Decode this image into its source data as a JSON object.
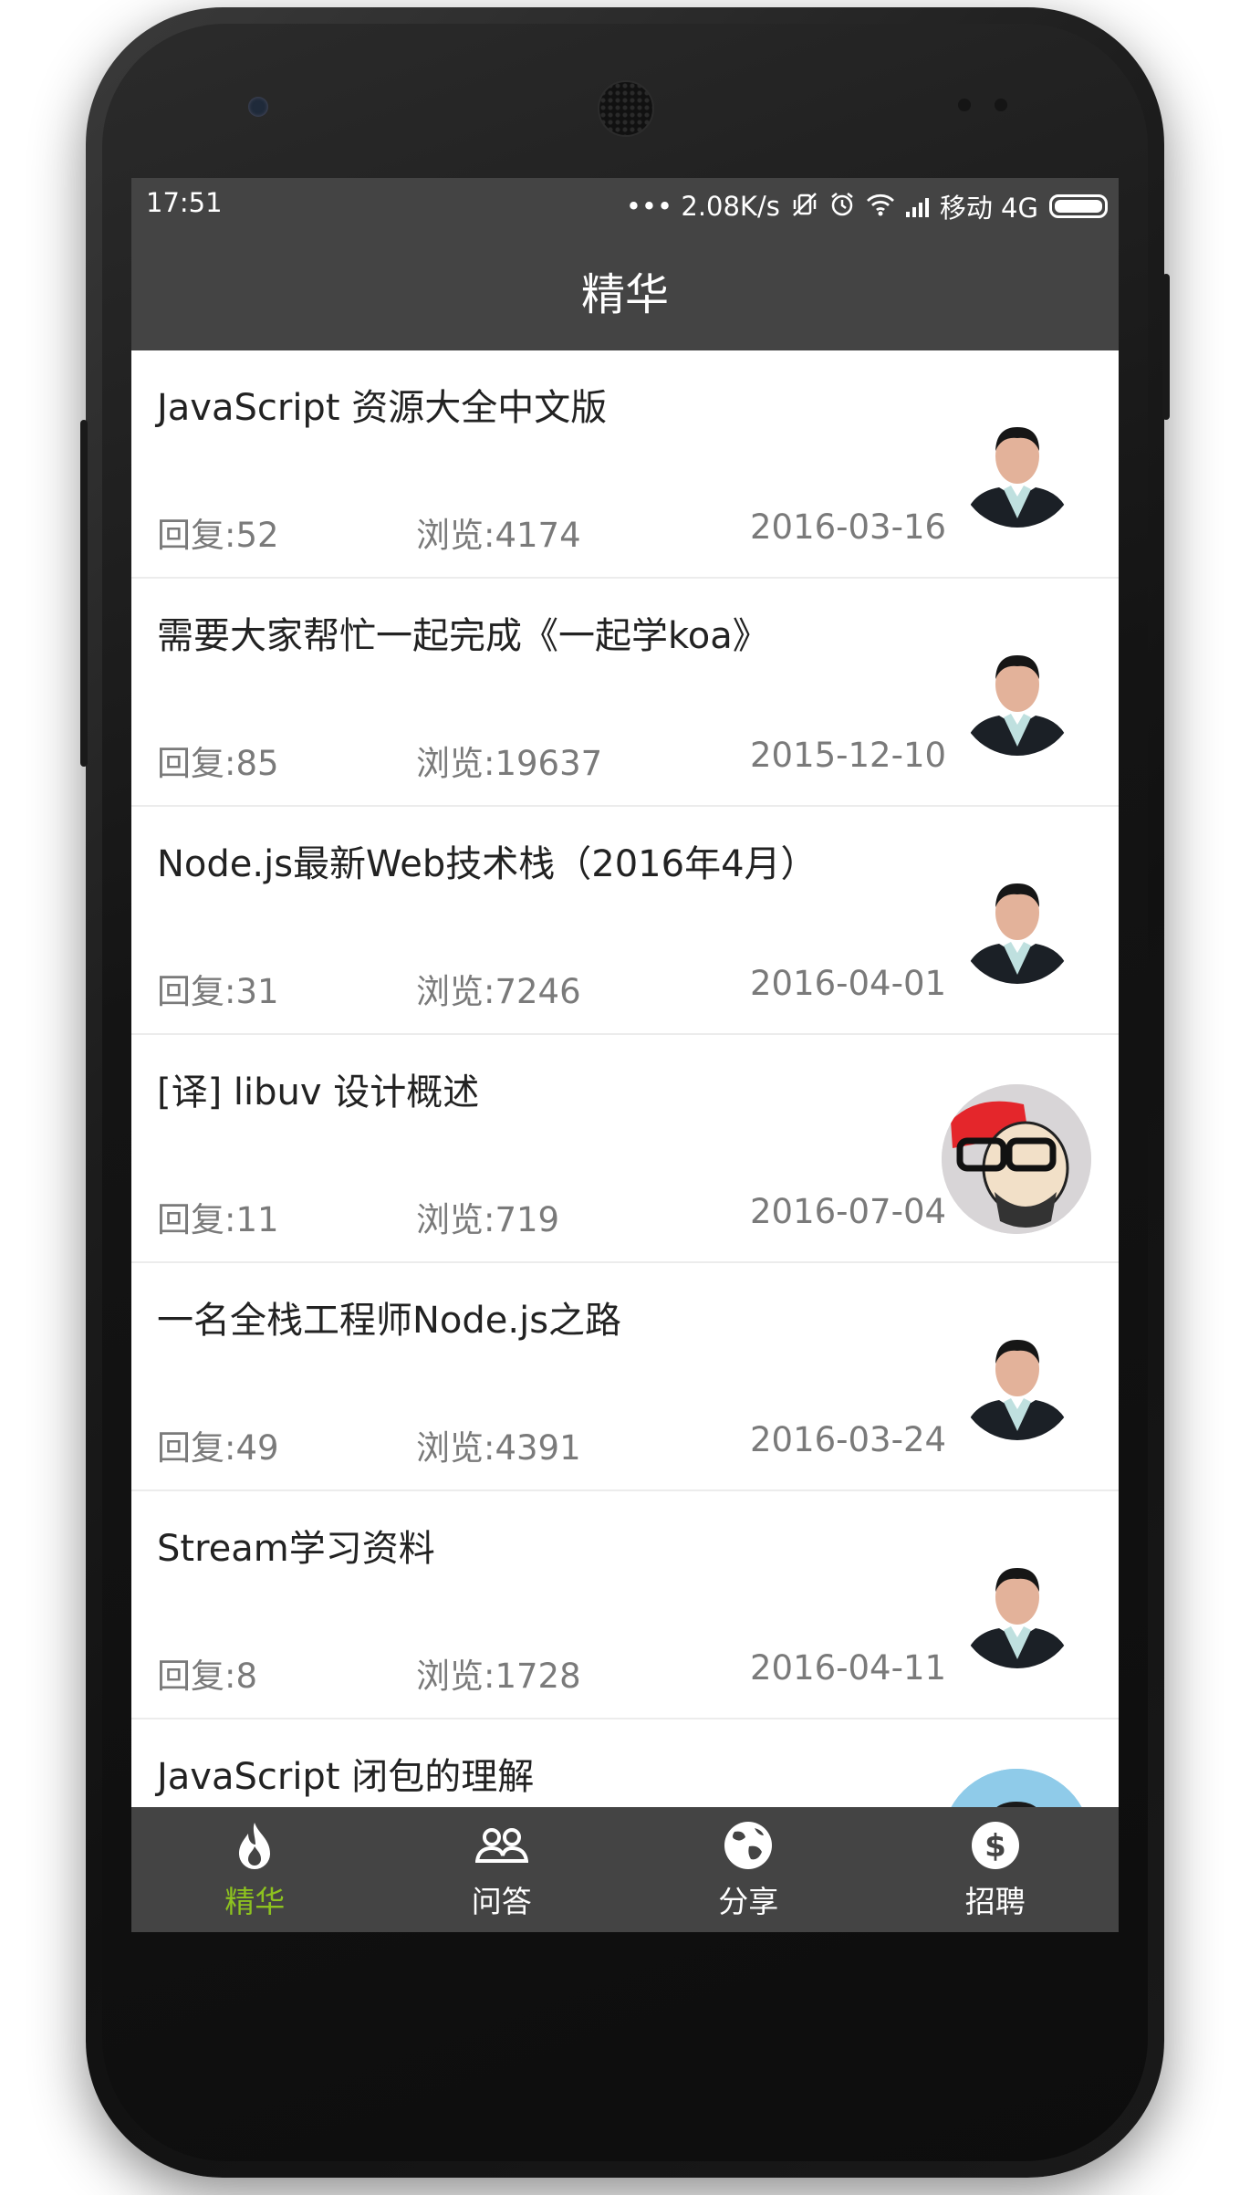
{
  "status_bar": {
    "time": "17:51",
    "net_speed": "••• 2.08K/s",
    "carrier": "移动 4G"
  },
  "header": {
    "title": "精华"
  },
  "topics": [
    {
      "title": "JavaScript 资源大全中文版",
      "reply": "回复:52",
      "views": "浏览:4174",
      "date": "2016-03-16",
      "avatar": "man-suit"
    },
    {
      "title": "需要大家帮忙一起完成《一起学koa》",
      "reply": "回复:85",
      "views": "浏览:19637",
      "date": "2015-12-10",
      "avatar": "man-suit"
    },
    {
      "title": "Node.js最新Web技术栈（2016年4月）",
      "reply": "回复:31",
      "views": "浏览:7246",
      "date": "2016-04-01",
      "avatar": "man-suit"
    },
    {
      "title": "[译] libuv 设计概述",
      "reply": "回复:11",
      "views": "浏览:719",
      "date": "2016-07-04",
      "avatar": "cartoon"
    },
    {
      "title": "一名全栈工程师Node.js之路",
      "reply": "回复:49",
      "views": "浏览:4391",
      "date": "2016-03-24",
      "avatar": "man-suit"
    },
    {
      "title": "Stream学习资料",
      "reply": "回复:8",
      "views": "浏览:1728",
      "date": "2016-04-11",
      "avatar": "man-suit"
    },
    {
      "title": "JavaScript 闭包的理解",
      "reply": "",
      "views": "",
      "date": "",
      "avatar": "photo"
    }
  ],
  "tabs": [
    {
      "label": "精华",
      "icon": "flame-icon",
      "active": true
    },
    {
      "label": "问答",
      "icon": "people-icon",
      "active": false
    },
    {
      "label": "分享",
      "icon": "globe-icon",
      "active": false
    },
    {
      "label": "招聘",
      "icon": "dollar-icon",
      "active": false
    }
  ],
  "colors": {
    "bar_bg": "#444444",
    "active_tab": "#8dc21f",
    "meta_text": "#7a7a7a"
  }
}
